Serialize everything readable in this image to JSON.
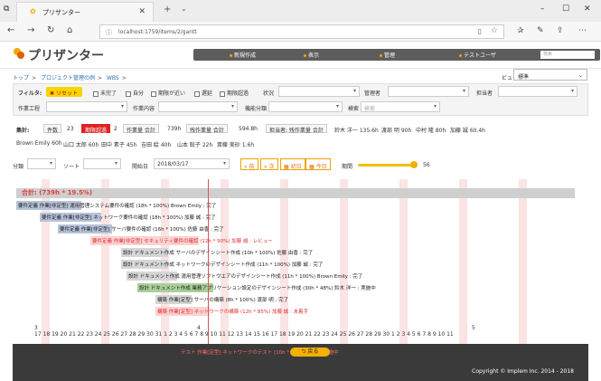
{
  "browser": {
    "tab_title": "プリザンター",
    "url": "localhost:1759/items/2/gantt"
  },
  "app": {
    "logo_text": "プリザンター",
    "menu": [
      "新規作成",
      "表示",
      "管理",
      "テストユーザ"
    ],
    "search_placeholder": "検索"
  },
  "breadcrumb": [
    "トップ",
    "プロジェクト管理の例",
    "WBS"
  ],
  "view": {
    "label": "ビュー",
    "value": "標準"
  },
  "filters": {
    "label": "フィルタ:",
    "reset": "リセット",
    "checkboxes": [
      "未完了",
      "自分",
      "期限が近い",
      "遅延",
      "期限超過"
    ],
    "status_label": "状況",
    "manager_label": "管理者",
    "person_label": "担当者",
    "row2": [
      "作業工程",
      "作業内容",
      "機能分類",
      "検索"
    ],
    "search_placeholder": "検索"
  },
  "stats": {
    "label": "集計:",
    "count_label": "件数",
    "count": "23",
    "overdue_label": "期限超過",
    "overdue": "2",
    "work_label": "作業量 合計",
    "work": "739h",
    "remain_label": "残作業量 合計",
    "remain": "594.8h",
    "person_label": "担当者: 残作業量 合計",
    "people": [
      "鈴木 洋一 135.6h",
      "渡部 明 90h",
      "中村 隆 80h",
      "加藤 誠 60.4h",
      "Brown Emily 60h",
      "山口 太郎 60h",
      "田中 素子 45h",
      "吉田 絵 40h",
      "山本 聡子 22h",
      "斎藤 美砂 1.6h"
    ]
  },
  "controls": {
    "group_label": "分類",
    "sort_label": "ソート",
    "start_label": "開始日",
    "start_date": "2018/03/17",
    "prev": "前",
    "next": "次",
    "first": "初日",
    "today": "今日",
    "period_label": "期間",
    "period_value": "56"
  },
  "gantt": {
    "summary": "合計: (739h * 19.5%)",
    "tasks": [
      {
        "text": "要件定義 作業[非定型] 運用管理システム要件の確認 (18h * 100%) Brown Emily : 完了"
      },
      {
        "text": "要件定義 作業[非定型] ネットワーク要件の確認 (18h * 100%) 加藤 誠 : 完了"
      },
      {
        "text": "要件定義 作業[非定型] サーバ要件の確認 (16h * 100%) 佐藤 由香 : 完了"
      },
      {
        "text": "要件定義 作業[非定型] セキュリティ要件の確認 (12h * 90%) 加藤 誠 : レビュー"
      },
      {
        "text": "設計 ドキュメント作成 サーバのデザインシート作成 (10h * 100%) 佐藤 由香 : 完了"
      },
      {
        "text": "設計 ドキュメント作成 ネットワークのデザインシート作成 (11h * 100%) 加藤 誠 : 完了"
      },
      {
        "text": "設計 ドキュメント作成 運用管理ソフトウエアのデザインシート作成 (11h * 100%) Brown Emily : 完了"
      },
      {
        "text": "設計 ドキュメント作成 業務アプリケーション設定のデザインシート作成 (30h * 48%) 鈴木 洋一 : 実施中"
      },
      {
        "text": "構築 作業[定型] サーバの構築 (8h * 100%) 渡部 明 : 完了"
      },
      {
        "text": "構築 作業[定型] ネットワークの構築 (12h * 85%) 加藤 誠 : 未着手"
      }
    ],
    "months": [
      "3",
      "4",
      "5"
    ],
    "days": "17 18 19 20 21 22 23 24 25 26 27 28 29 30 31 1 2 3 4 5 6 7 8 9 10 11 12 13 14 15 16 17 18 19 20 21 22 23 24 25 26 27 28 29 30 1 2 3 4 5 6 7 8 9 10 11"
  },
  "footer": {
    "back": "戻る",
    "copyright": "Copyright © Implem Inc. 2014 - 2018",
    "hidden_task": "テスト 作業[定型] ネットワークのテスト (10h * 0%) 加藤 誠 : 実施中"
  },
  "colors": {
    "accent": "#f2b000",
    "overdue": "#e02020",
    "menu_bg": "#5d5d5d"
  }
}
